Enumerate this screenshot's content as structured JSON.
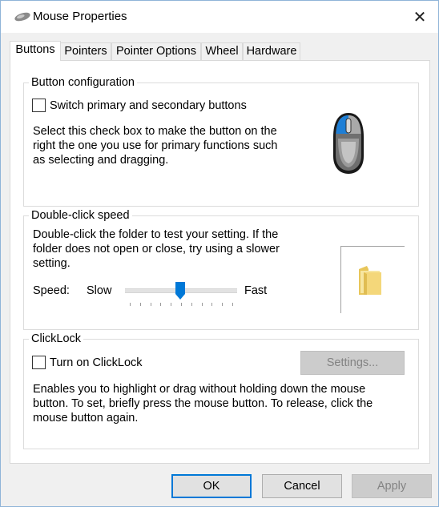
{
  "window": {
    "title": "Mouse Properties",
    "close_glyph": "✕"
  },
  "tabs": [
    {
      "label": "Buttons",
      "active": true
    },
    {
      "label": "Pointers",
      "active": false
    },
    {
      "label": "Pointer Options",
      "active": false
    },
    {
      "label": "Wheel",
      "active": false
    },
    {
      "label": "Hardware",
      "active": false
    }
  ],
  "button_config": {
    "title": "Button configuration",
    "checkbox_label": "Switch primary and secondary buttons",
    "checked": false,
    "description_lines": [
      "Select this check box to make the button on the",
      "right the one you use for primary functions such",
      "as selecting and dragging."
    ],
    "icon": "mouse-icon"
  },
  "double_click": {
    "title": "Double-click speed",
    "description_lines": [
      "Double-click the folder to test your setting. If the",
      "folder does not open or close, try using a slower",
      "setting."
    ],
    "speed_label": "Speed:",
    "slow_label": "Slow",
    "fast_label": "Fast",
    "speed_value_fraction": 0.49,
    "icon": "folder-icon"
  },
  "clicklock": {
    "title": "ClickLock",
    "checkbox_label": "Turn on ClickLock",
    "checked": false,
    "settings_label": "Settings...",
    "description_lines": [
      "Enables you to highlight or drag without holding down the mouse",
      "button. To set, briefly press the mouse button. To release, click the",
      "mouse button again."
    ]
  },
  "footer": {
    "ok_label": "OK",
    "cancel_label": "Cancel",
    "apply_label": "Apply"
  },
  "colors": {
    "accent": "#0078d7",
    "window_bg": "#f0f0f0",
    "panel_bg": "#ffffff"
  }
}
